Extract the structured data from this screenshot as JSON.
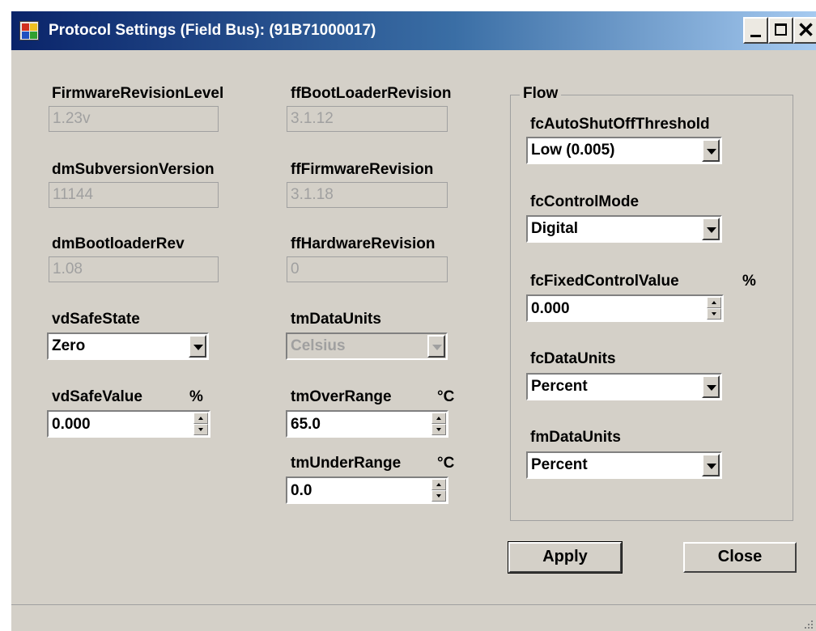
{
  "window": {
    "title": "Protocol Settings (Field Bus): (91B71000017)",
    "icon": "app-settings-icon"
  },
  "caption_buttons": {
    "minimize": "minimize-icon",
    "maximize": "maximize-icon",
    "close": "✕"
  },
  "left_column": {
    "firmware_revision_level": {
      "label": "FirmwareRevisionLevel",
      "value": "1.23v"
    },
    "dm_subversion_version": {
      "label": "dmSubversionVersion",
      "value": "11144"
    },
    "dm_bootloader_rev": {
      "label": "dmBootloaderRev",
      "value": "1.08"
    },
    "vd_safe_state": {
      "label": "vdSafeState",
      "value": "Zero"
    },
    "vd_safe_value": {
      "label": "vdSafeValue",
      "unit": "%",
      "value": "0.000"
    }
  },
  "middle_column": {
    "ff_boot_loader_revision": {
      "label": "ffBootLoaderRevision",
      "value": "3.1.12"
    },
    "ff_firmware_revision": {
      "label": "ffFirmwareRevision",
      "value": "3.1.18"
    },
    "ff_hardware_revision": {
      "label": "ffHardwareRevision",
      "value": "0"
    },
    "tm_data_units": {
      "label": "tmDataUnits",
      "value": "Celsius"
    },
    "tm_over_range": {
      "label": "tmOverRange",
      "unit": "°C",
      "value": "65.0"
    },
    "tm_under_range": {
      "label": "tmUnderRange",
      "unit": "°C",
      "value": "0.0"
    }
  },
  "flow_group": {
    "title": "Flow",
    "fc_auto_shut_off_threshold": {
      "label": "fcAutoShutOffThreshold",
      "value": "Low (0.005)"
    },
    "fc_control_mode": {
      "label": "fcControlMode",
      "value": "Digital"
    },
    "fc_fixed_control_value": {
      "label": "fcFixedControlValue",
      "unit": "%",
      "value": "0.000"
    },
    "fc_data_units": {
      "label": "fcDataUnits",
      "value": "Percent"
    },
    "fm_data_units": {
      "label": "fmDataUnits",
      "value": "Percent"
    }
  },
  "buttons": {
    "apply": "Apply",
    "close": "Close"
  },
  "colors": {
    "title_bar_start": "#0a246a",
    "title_bar_end": "#a6caf0",
    "window_background": "#d4d0c8",
    "disabled_text": "#a0a0a0"
  }
}
